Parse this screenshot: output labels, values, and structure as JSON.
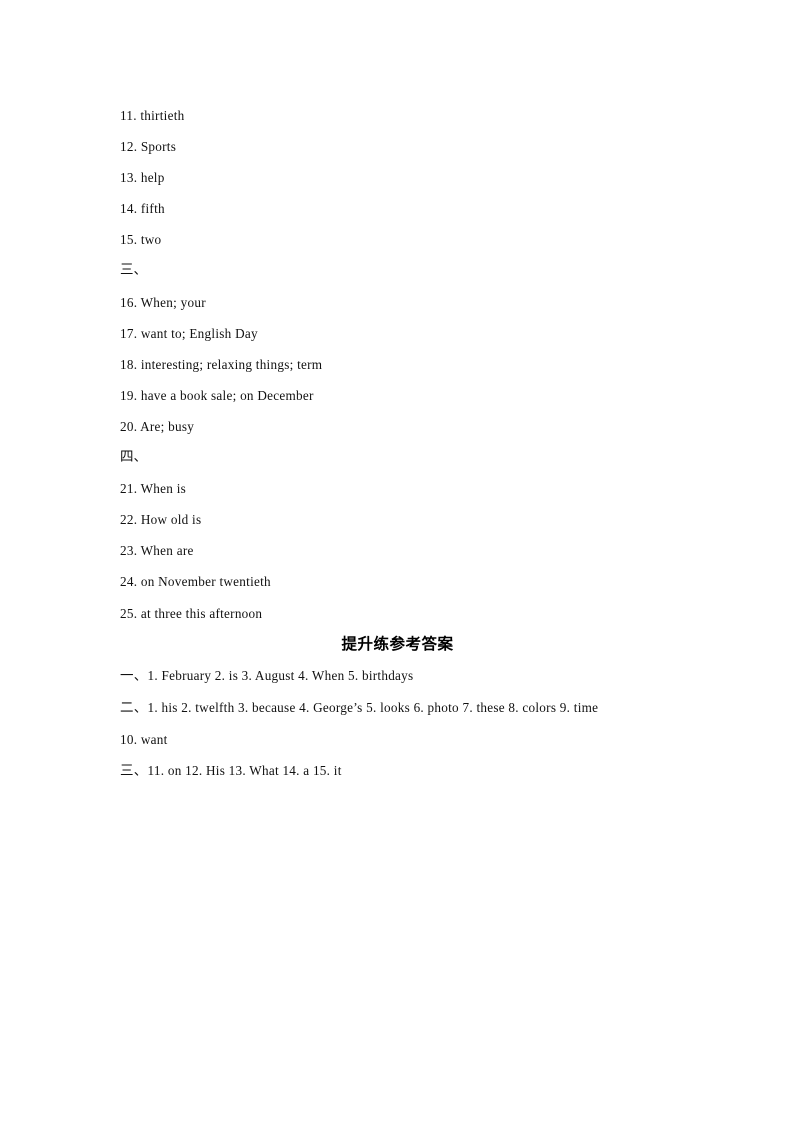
{
  "document": {
    "page_size": "A4",
    "background_color": "#ffffff",
    "text_color": "#111111"
  },
  "section_two_answers": [
    "11. thirtieth",
    "12. Sports",
    "13. help",
    "14. fifth",
    "15. two"
  ],
  "section_three": {
    "marker": "三、",
    "answers": [
      "16. When; your",
      "17. want to; English Day",
      "18. interesting; relaxing things; term",
      "19. have a book sale; on December",
      "20. Are; busy"
    ]
  },
  "section_four": {
    "marker": "四、",
    "answers": [
      "21. When is",
      "22. How old is",
      "23. When are",
      "24. on November twentieth",
      "25. at three this afternoon"
    ]
  },
  "improvement_section": {
    "heading": "提升练参考答案",
    "groups": [
      {
        "marker": "一、",
        "text": "1. February 2. is 3. August 4. When 5. birthdays"
      },
      {
        "marker": "二、",
        "text": "1. his 2. twelfth 3. because 4. George’s 5. looks 6. photo 7. these 8. colors 9. time"
      }
    ],
    "continuation": "10. want",
    "group_three": {
      "marker": "三、",
      "text": "11. on 12. His 13. What 14. a 15. it"
    }
  }
}
